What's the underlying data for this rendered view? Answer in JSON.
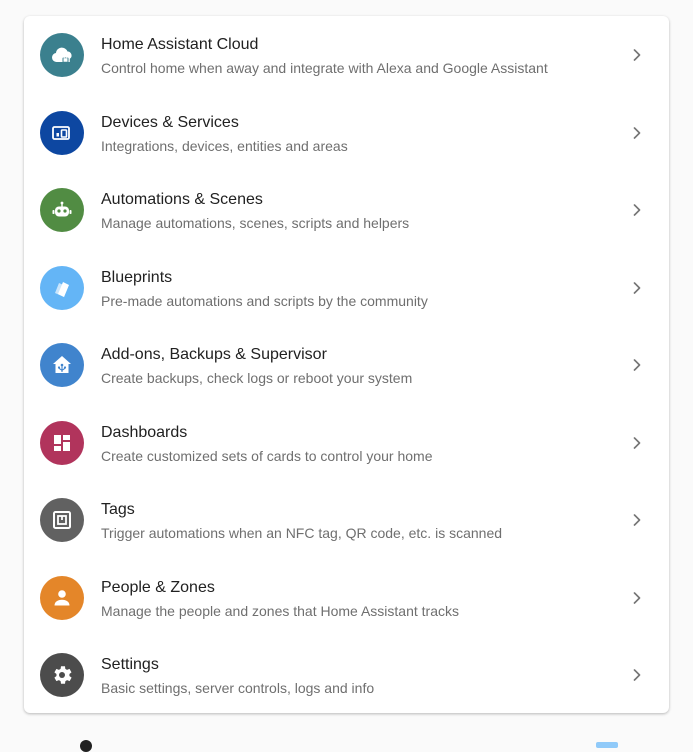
{
  "menu": {
    "items": [
      {
        "title": "Home Assistant Cloud",
        "subtitle": "Control home when away and integrate with Alexa and Google Assistant",
        "icon": "cloud-lock-icon",
        "color": "#3b808e"
      },
      {
        "title": "Devices & Services",
        "subtitle": "Integrations, devices, entities and areas",
        "icon": "devices-icon",
        "color": "#0d47a1"
      },
      {
        "title": "Automations & Scenes",
        "subtitle": "Manage automations, scenes, scripts and helpers",
        "icon": "robot-icon",
        "color": "#518c43"
      },
      {
        "title": "Blueprints",
        "subtitle": "Pre-made automations and scripts by the community",
        "icon": "blueprint-icon",
        "color": "#64b5f6"
      },
      {
        "title": "Add-ons, Backups & Supervisor",
        "subtitle": "Create backups, check logs or reboot your system",
        "icon": "home-assistant-icon",
        "color": "#4084cd"
      },
      {
        "title": "Dashboards",
        "subtitle": "Create customized sets of cards to control your home",
        "icon": "dashboard-icon",
        "color": "#b1345c"
      },
      {
        "title": "Tags",
        "subtitle": "Trigger automations when an NFC tag, QR code, etc. is scanned",
        "icon": "nfc-tag-icon",
        "color": "#616161"
      },
      {
        "title": "People & Zones",
        "subtitle": "Manage the people and zones that Home Assistant tracks",
        "icon": "account-icon",
        "color": "#e48629"
      },
      {
        "title": "Settings",
        "subtitle": "Basic settings, server controls, logs and info",
        "icon": "cog-icon",
        "color": "#4c4c4c"
      }
    ]
  }
}
